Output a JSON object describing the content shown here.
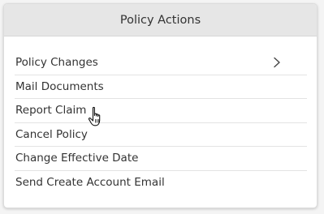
{
  "panel": {
    "title": "Policy Actions",
    "items": [
      {
        "label": "Policy Changes",
        "icon": "chevron-right-icon"
      },
      {
        "label": "Mail Documents"
      },
      {
        "label": "Report Claim"
      },
      {
        "label": "Cancel Policy"
      },
      {
        "label": "Change Effective Date"
      },
      {
        "label": "Send Create Account Email"
      }
    ]
  },
  "pointer": {
    "icon": "hand-pointer-icon"
  },
  "colors": {
    "header_bg": "#e6e6e6",
    "text": "#333333",
    "divider": "#e3e3e3"
  }
}
